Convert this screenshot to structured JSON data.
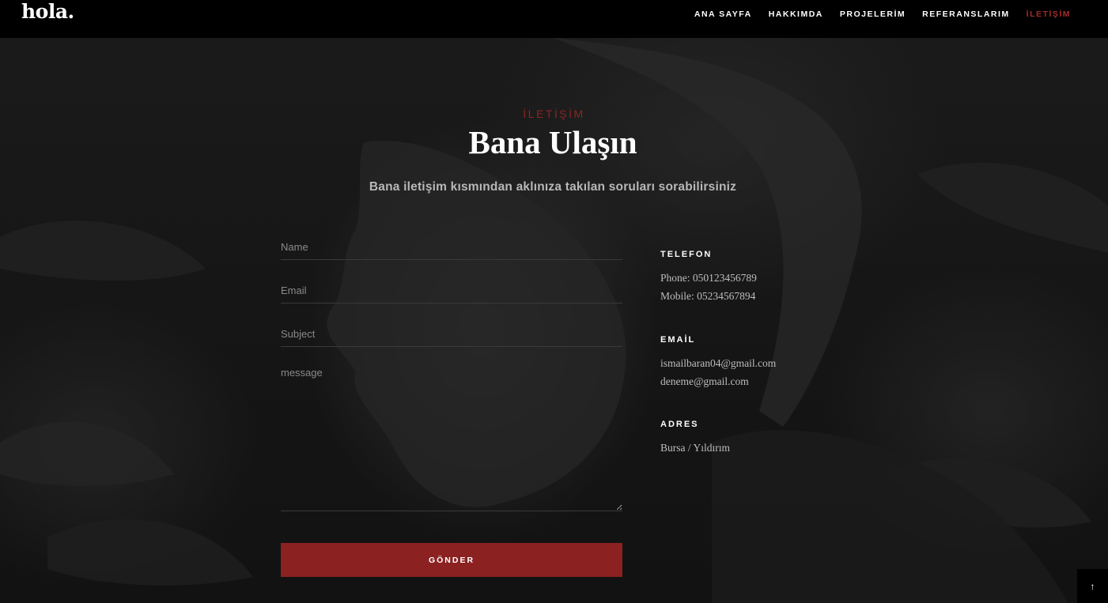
{
  "brand": {
    "logo": "hola."
  },
  "nav": {
    "items": [
      "ANA SAYFA",
      "HAKKIMDA",
      "PROJELERİM",
      "REFERANSLARIM",
      "İLETİŞİM"
    ],
    "active_index": 4,
    "active_color": "#a52a2a"
  },
  "contact": {
    "eyebrow": "İLETİŞİM",
    "title": "Bana Ulaşın",
    "subtitle": "Bana iletişim kısmından aklınıza takılan soruları sorabilirsiniz"
  },
  "form": {
    "name_placeholder": "Name",
    "email_placeholder": "Email",
    "subject_placeholder": "Subject",
    "message_placeholder": "message",
    "submit_label": "GÖNDER",
    "submit_color": "#8b2121"
  },
  "info": {
    "phone": {
      "heading": "TELEFON",
      "line1": "Phone: 050123456789",
      "line2": "Mobile: 05234567894"
    },
    "email": {
      "heading": "EMAİL",
      "line1": "ismailbaran04@gmail.com",
      "line2": "deneme@gmail.com"
    },
    "address": {
      "heading": "ADRES",
      "line1": "Bursa / Yıldırım"
    }
  },
  "back_to_top": {
    "icon": "arrow-up-icon",
    "glyph": "↑"
  }
}
